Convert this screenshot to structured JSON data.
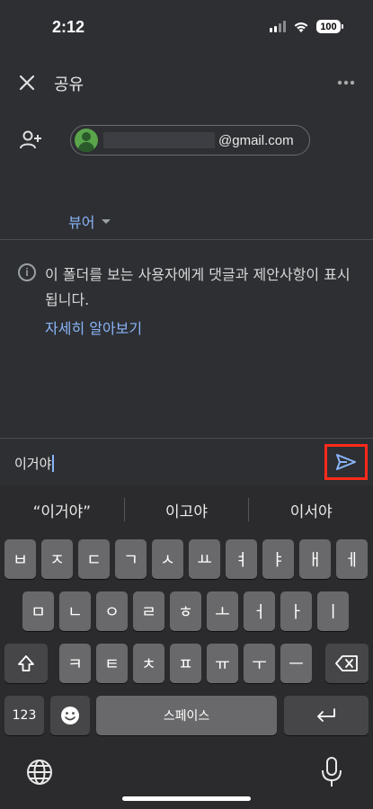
{
  "status_bar": {
    "time": "2:12",
    "battery": "100"
  },
  "app_bar": {
    "title": "공유"
  },
  "recipient": {
    "email_suffix": "@gmail.com"
  },
  "role": {
    "label": "뷰어"
  },
  "info": {
    "text": "이 폴더를 보는 사용자에게 댓글과 제안사항이 표시됩니다.",
    "learn_more": "자세히 알아보기"
  },
  "message": {
    "value": "이거야"
  },
  "keyboard": {
    "suggestions": [
      "“이거야”",
      "이고야",
      "이서야"
    ],
    "row1": [
      "ㅂ",
      "ㅈ",
      "ㄷ",
      "ㄱ",
      "ㅅ",
      "ㅛ",
      "ㅕ",
      "ㅑ",
      "ㅐ",
      "ㅔ"
    ],
    "row2": [
      "ㅁ",
      "ㄴ",
      "ㅇ",
      "ㄹ",
      "ㅎ",
      "ㅗ",
      "ㅓ",
      "ㅏ",
      "ㅣ"
    ],
    "row3": [
      "ㅋ",
      "ㅌ",
      "ㅊ",
      "ㅍ",
      "ㅠ",
      "ㅜ",
      "ㅡ"
    ],
    "numbers_label": "123",
    "space_label": "스페이스"
  }
}
